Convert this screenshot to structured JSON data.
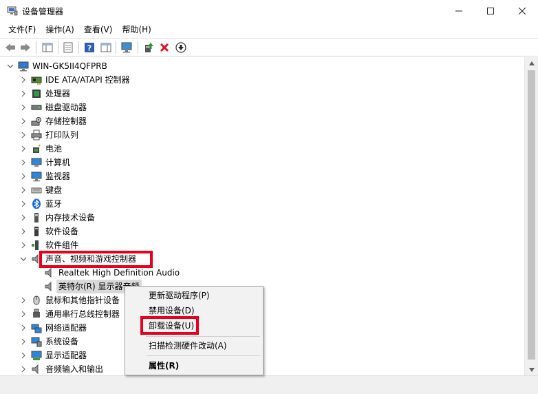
{
  "window": {
    "title": "设备管理器",
    "min_glyph": "—",
    "max_glyph": "☐",
    "close_glyph": "✕"
  },
  "menubar": {
    "items": [
      "文件(F)",
      "操作(A)",
      "查看(V)",
      "帮助(H)"
    ]
  },
  "tree": {
    "root": "WIN-GK5II4QFPRB",
    "categories": [
      {
        "label": "IDE ATA/ATAPI 控制器",
        "icon": "ide-controller-icon"
      },
      {
        "label": "处理器",
        "icon": "processor-icon"
      },
      {
        "label": "磁盘驱动器",
        "icon": "disk-drive-icon"
      },
      {
        "label": "存储控制器",
        "icon": "storage-controller-icon"
      },
      {
        "label": "打印队列",
        "icon": "printer-icon"
      },
      {
        "label": "电池",
        "icon": "battery-icon"
      },
      {
        "label": "计算机",
        "icon": "computer-icon"
      },
      {
        "label": "监视器",
        "icon": "monitor-icon"
      },
      {
        "label": "键盘",
        "icon": "keyboard-icon"
      },
      {
        "label": "蓝牙",
        "icon": "bluetooth-icon"
      },
      {
        "label": "内存技术设备",
        "icon": "memory-device-icon"
      },
      {
        "label": "软件设备",
        "icon": "software-device-icon"
      },
      {
        "label": "软件组件",
        "icon": "software-component-icon"
      }
    ],
    "expanded_category": "声音、视频和游戏控制器",
    "expanded_children": [
      "Realtek High Definition Audio",
      "英特尔(R) 显示器音频"
    ],
    "categories_after": [
      {
        "label": "鼠标和其他指针设备",
        "icon": "mouse-icon"
      },
      {
        "label": "通用串行总线控制器",
        "icon": "usb-icon"
      },
      {
        "label": "网络适配器",
        "icon": "network-adapter-icon"
      },
      {
        "label": "系统设备",
        "icon": "system-device-icon"
      },
      {
        "label": "显示适配器",
        "icon": "display-adapter-icon"
      },
      {
        "label": "音频输入和输出",
        "icon": "audio-io-icon"
      }
    ]
  },
  "context_menu": {
    "update_driver": "更新驱动程序(P)",
    "disable_device": "禁用设备(D)",
    "uninstall_device": "卸载设备(U)",
    "scan_hardware": "扫描检测硬件改动(A)",
    "properties": "属性(R)"
  },
  "colors": {
    "highlight_red": "#e8001c",
    "menu_bg": "#f2f2f2",
    "scrollbar": "#f0f0f0"
  }
}
